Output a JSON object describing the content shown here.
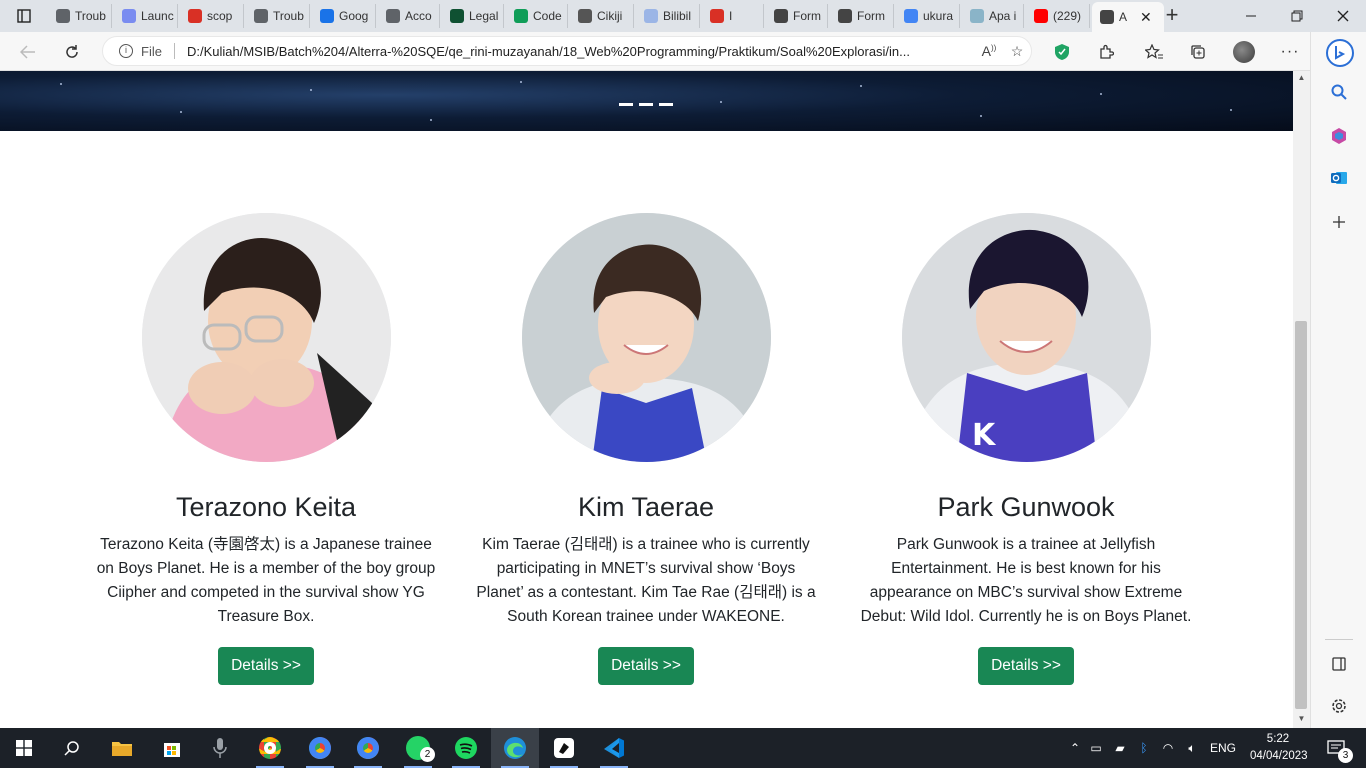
{
  "browser": {
    "tabs": [
      {
        "label": "Troub",
        "icon": "leaf-icon",
        "color": "#5f6368"
      },
      {
        "label": "Launc",
        "icon": "zoom-icon",
        "color": "#7a8cf0"
      },
      {
        "label": "scop",
        "icon": "pdf-icon",
        "color": "#d93025"
      },
      {
        "label": "Troub",
        "icon": "leaf-icon",
        "color": "#5f6368"
      },
      {
        "label": "Goog",
        "icon": "drive-icon",
        "color": "#1a73e8"
      },
      {
        "label": "Acco",
        "icon": "leaf-icon",
        "color": "#5f6368"
      },
      {
        "label": "Legal",
        "icon": "leaf-icon",
        "color": "#0f5132"
      },
      {
        "label": "Code",
        "icon": "plus-square-icon",
        "color": "#0f9d58"
      },
      {
        "label": "Cikiji",
        "icon": "eye-icon",
        "color": "#555555"
      },
      {
        "label": "Bilibil",
        "icon": "tv-icon",
        "color": "#9bb5e6"
      },
      {
        "label": "I",
        "icon": "record-icon",
        "color": "#d93025"
      },
      {
        "label": "Form",
        "icon": "doc-icon",
        "color": "#444444"
      },
      {
        "label": "Form",
        "icon": "doc-icon",
        "color": "#444444"
      },
      {
        "label": "ukura",
        "icon": "google-icon",
        "color": "#4285f4"
      },
      {
        "label": "Apa i",
        "icon": "cloud-icon",
        "color": "#8ab4c8"
      },
      {
        "label": "(229)",
        "icon": "youtube-icon",
        "color": "#ff0000"
      },
      {
        "label": "A",
        "icon": "page-icon",
        "color": "#444444"
      }
    ],
    "url_scheme": "File",
    "url": "D:/Kuliah/MSIB/Batch%204/Alterra-%20SQE/qe_rini-muzayanah/18_Web%20Programming/Praktikum/Soal%20Explorasi/in..."
  },
  "page": {
    "profiles": [
      {
        "name": "Terazono Keita",
        "description": "Terazono Keita (寺園啓太) is a Japanese trainee on Boys Planet. He is a member of the boy group Ciipher and competed in the survival show YG Treasure Box.",
        "button": "Details >>",
        "shirt_color": "#f2a9c4"
      },
      {
        "name": "Kim Taerae",
        "description": "Kim Taerae (김태래) is a trainee who is currently participating in MNET’s survival show ‘Boys Planet’ as a contestant. Kim Tae Rae (김태래) is a South Korean trainee under WAKEONE.",
        "button": "Details >>",
        "shirt_color": "#3a48c4"
      },
      {
        "name": "Park Gunwook",
        "description": "Park Gunwook is a trainee at Jellyfish Entertainment. He is best known for his appearance on MBC’s survival show Extreme Debut: Wild Idol. Currently he is on Boys Planet.",
        "button": "Details >>",
        "shirt_color": "#4a3fc0"
      }
    ],
    "accent_color": "#198754"
  },
  "taskbar": {
    "whatsapp_badge": "2",
    "language": "ENG",
    "time": "5:22",
    "date": "04/04/2023",
    "notification_count": "3"
  }
}
